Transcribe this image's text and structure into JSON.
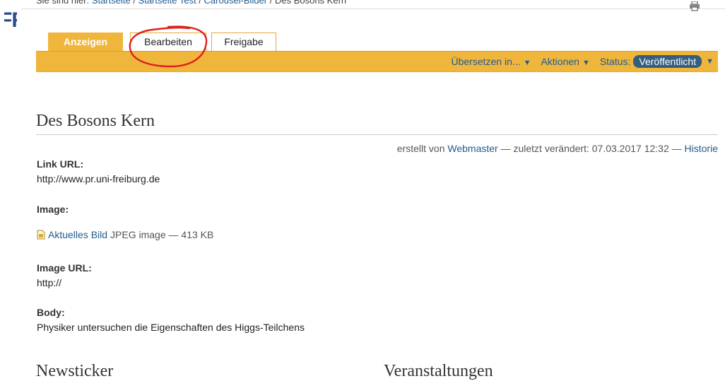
{
  "logo": {
    "text": "FRI"
  },
  "breadcrumb": {
    "prefix": "Sie sind hier:",
    "items": [
      "Startseite",
      "Startseite Test",
      "Carousel-Bilder",
      "Des Bosons Kern"
    ]
  },
  "tabs": {
    "view": "Anzeigen",
    "edit": "Bearbeiten",
    "share": "Freigabe"
  },
  "contentbar": {
    "translate": "Übersetzen in...",
    "actions": "Aktionen",
    "status_label": "Status:",
    "status_value": "Veröffentlicht",
    "caret": "▼"
  },
  "page": {
    "title": "Des Bosons Kern",
    "byline": {
      "created_by": "erstellt von",
      "author": "Webmaster",
      "modified_label": "— zuletzt verändert: 07.03.2017 12:32 —",
      "history": "Historie"
    }
  },
  "fields": {
    "link_url_label": "Link URL:",
    "link_url_value": "http://www.pr.uni-freiburg.de",
    "image_label": "Image:",
    "image_link": "Aktuelles Bild",
    "image_meta": "JPEG image — 413 KB",
    "image_url_label": "Image URL:",
    "image_url_value": "http://",
    "body_label": "Body:",
    "body_value": "Physiker untersuchen die Eigenschaften des Higgs-Teilchens"
  },
  "portlets": {
    "left": "Newsticker",
    "right": "Veranstaltungen"
  },
  "colors": {
    "accent": "#f0b63c",
    "link": "#205c90",
    "badge": "#345d7e",
    "annotation": "#e0201c"
  },
  "icons": [
    "print-icon",
    "file-icon"
  ]
}
